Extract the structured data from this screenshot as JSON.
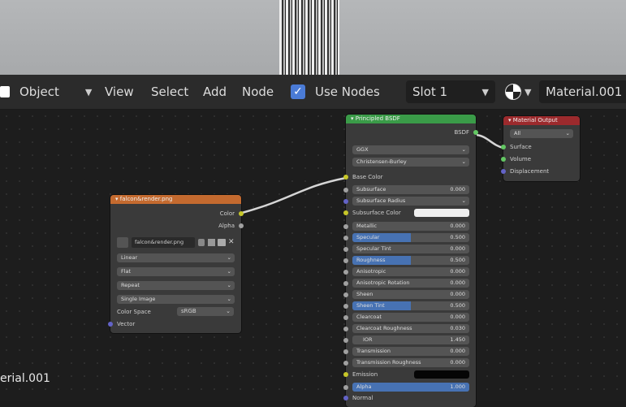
{
  "header": {
    "mode": "Object",
    "menus": [
      "View",
      "Select",
      "Add",
      "Node"
    ],
    "use_nodes_label": "Use Nodes",
    "slot": "Slot 1",
    "material_name": "Material.001"
  },
  "canvas_label": "erial.001",
  "image_node": {
    "title": "falcon&render.png",
    "out_color": "Color",
    "out_alpha": "Alpha",
    "image_name": "falcon&render.png",
    "interp": "Linear",
    "projection": "Flat",
    "extension": "Repeat",
    "source": "Single Image",
    "color_space_label": "Color Space",
    "color_space": "sRGB",
    "vector": "Vector"
  },
  "bsdf_node": {
    "title": "Principled BSDF",
    "out": "BSDF",
    "distribution": "GGX",
    "subsurface_method": "Christensen-Burley",
    "base_color": "Base Color",
    "subsurface": {
      "label": "Subsurface",
      "value": "0.000"
    },
    "subsurface_radius": "Subsurface Radius",
    "subsurface_color": "Subsurface Color",
    "metallic": {
      "label": "Metallic",
      "value": "0.000"
    },
    "specular": {
      "label": "Specular",
      "value": "0.500",
      "fraction": 0.5
    },
    "specular_tint": {
      "label": "Specular Tint",
      "value": "0.000"
    },
    "roughness": {
      "label": "Roughness",
      "value": "0.500",
      "fraction": 0.5
    },
    "anisotropic": {
      "label": "Anisotropic",
      "value": "0.000"
    },
    "anisotropic_rotation": {
      "label": "Anisotropic Rotation",
      "value": "0.000"
    },
    "sheen": {
      "label": "Sheen",
      "value": "0.000"
    },
    "sheen_tint": {
      "label": "Sheen Tint",
      "value": "0.500",
      "fraction": 0.5
    },
    "clearcoat": {
      "label": "Clearcoat",
      "value": "0.000"
    },
    "clearcoat_roughness": {
      "label": "Clearcoat Roughness",
      "value": "0.030"
    },
    "ior": {
      "label": "IOR",
      "value": "1.450"
    },
    "transmission": {
      "label": "Transmission",
      "value": "0.000"
    },
    "transmission_roughness": {
      "label": "Transmission Roughness",
      "value": "0.000"
    },
    "emission": "Emission",
    "alpha": {
      "label": "Alpha",
      "value": "1.000",
      "fraction": 1.0
    },
    "normal": "Normal"
  },
  "output_node": {
    "title": "Material Output",
    "target": "All",
    "surface": "Surface",
    "volume": "Volume",
    "displacement": "Displacement"
  },
  "colors": {
    "texture_header": "#c46a2f",
    "shader_header": "#3a9b48",
    "output_header": "#9c2a2d",
    "accent": "#4772b3"
  }
}
